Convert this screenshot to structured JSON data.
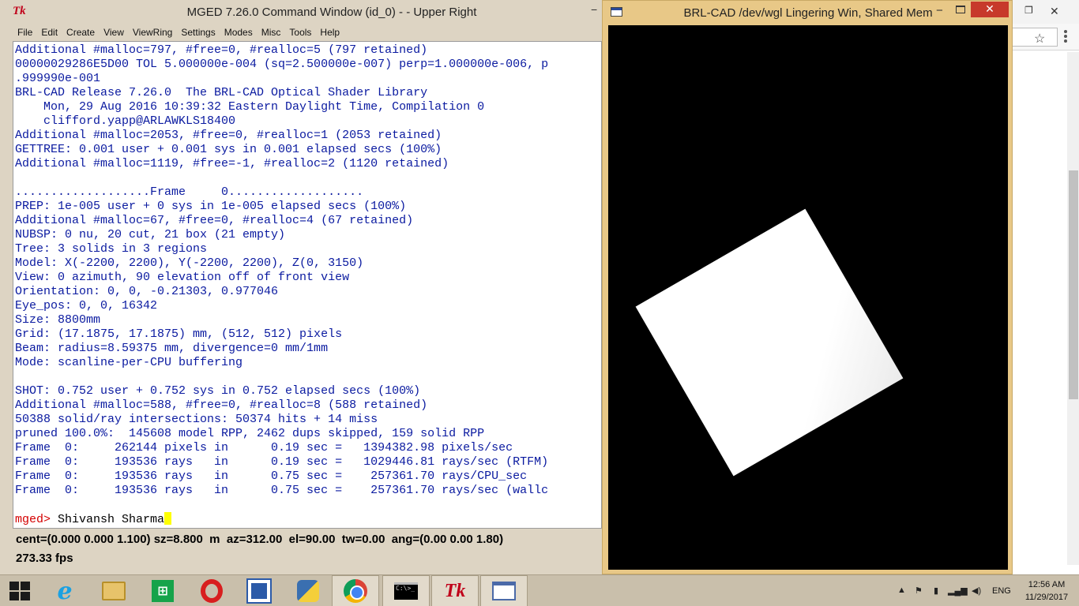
{
  "mged": {
    "title": "MGED 7.26.0 Command Window (id_0) -  - Upper Right",
    "app_icon": "tk-feather-icon",
    "minimize_glyph": "−",
    "menus": [
      "File",
      "Edit",
      "Create",
      "View",
      "ViewRing",
      "Settings",
      "Modes",
      "Misc",
      "Tools",
      "Help"
    ],
    "console_lines": [
      "Additional #malloc=797, #free=0, #realloc=5 (797 retained)",
      "00000029286E5D00 TOL 5.000000e-004 (sq=2.500000e-007) perp=1.000000e-006, p",
      ".999990e-001",
      "BRL-CAD Release 7.26.0  The BRL-CAD Optical Shader Library",
      "    Mon, 29 Aug 2016 10:39:32 Eastern Daylight Time, Compilation 0",
      "    clifford.yapp@ARLAWKLS18400",
      "Additional #malloc=2053, #free=0, #realloc=1 (2053 retained)",
      "GETTREE: 0.001 user + 0.001 sys in 0.001 elapsed secs (100%)",
      "Additional #malloc=1119, #free=-1, #realloc=2 (1120 retained)",
      "",
      "...................Frame     0...................",
      "PREP: 1e-005 user + 0 sys in 1e-005 elapsed secs (100%)",
      "Additional #malloc=67, #free=0, #realloc=4 (67 retained)",
      "NUBSP: 0 nu, 20 cut, 21 box (21 empty)",
      "Tree: 3 solids in 3 regions",
      "Model: X(-2200, 2200), Y(-2200, 2200), Z(0, 3150)",
      "View: 0 azimuth, 90 elevation off of front view",
      "Orientation: 0, 0, -0.21303, 0.977046",
      "Eye_pos: 0, 0, 16342",
      "Size: 8800mm",
      "Grid: (17.1875, 17.1875) mm, (512, 512) pixels",
      "Beam: radius=8.59375 mm, divergence=0 mm/1mm",
      "Mode: scanline-per-CPU buffering",
      "",
      "SHOT: 0.752 user + 0.752 sys in 0.752 elapsed secs (100%)",
      "Additional #malloc=588, #free=0, #realloc=8 (588 retained)",
      "50388 solid/ray intersections: 50374 hits + 14 miss",
      "pruned 100.0%:  145608 model RPP, 2462 dups skipped, 159 solid RPP",
      "Frame  0:     262144 pixels in      0.19 sec =   1394382.98 pixels/sec",
      "Frame  0:     193536 rays   in      0.19 sec =   1029446.81 rays/sec (RTFM)",
      "Frame  0:     193536 rays   in      0.75 sec =    257361.70 rays/CPU_sec",
      "Frame  0:     193536 rays   in      0.75 sec =    257361.70 rays/sec (wallc"
    ],
    "prompt": "mged>",
    "command_value": " Shivansh Sharma",
    "status_line": "cent=(0.000 0.000 1.100) sz=8.800  m  az=312.00  el=90.00  tw=0.00  ang=(0.00 0.00 1.80)",
    "fps": "273.33 fps"
  },
  "graphics": {
    "title": "BRL-CAD /dev/wgl Lingering Win, Shared Mem",
    "minimize_glyph": "−",
    "close_glyph": "✕",
    "canvas_color": "#000000",
    "shape_color": "#ffffff",
    "shape_rotation_deg": -30
  },
  "background_window": {
    "restore_glyph": "❐",
    "close_glyph": "✕",
    "star_glyph": "☆"
  },
  "taskbar": {
    "apps": [
      {
        "name": "internet-explorer-icon",
        "glyph": "e"
      },
      {
        "name": "file-explorer-icon",
        "glyph": ""
      },
      {
        "name": "windows-store-icon",
        "glyph": "⊞"
      },
      {
        "name": "opera-icon",
        "glyph": ""
      },
      {
        "name": "remote-desktop-icon",
        "glyph": ""
      },
      {
        "name": "python-icon",
        "glyph": ""
      },
      {
        "name": "chrome-icon",
        "glyph": ""
      },
      {
        "name": "command-prompt-icon",
        "glyph": "C:\\>_"
      },
      {
        "name": "tk-mged-icon",
        "glyph": "Tk"
      },
      {
        "name": "wish-window-icon",
        "glyph": ""
      }
    ],
    "tray_glyphs": [
      "▲",
      "⚑",
      "▮",
      "▂▄▆",
      "◀)"
    ],
    "language": "ENG",
    "time": "12:56 AM",
    "date": "11/29/2017"
  }
}
